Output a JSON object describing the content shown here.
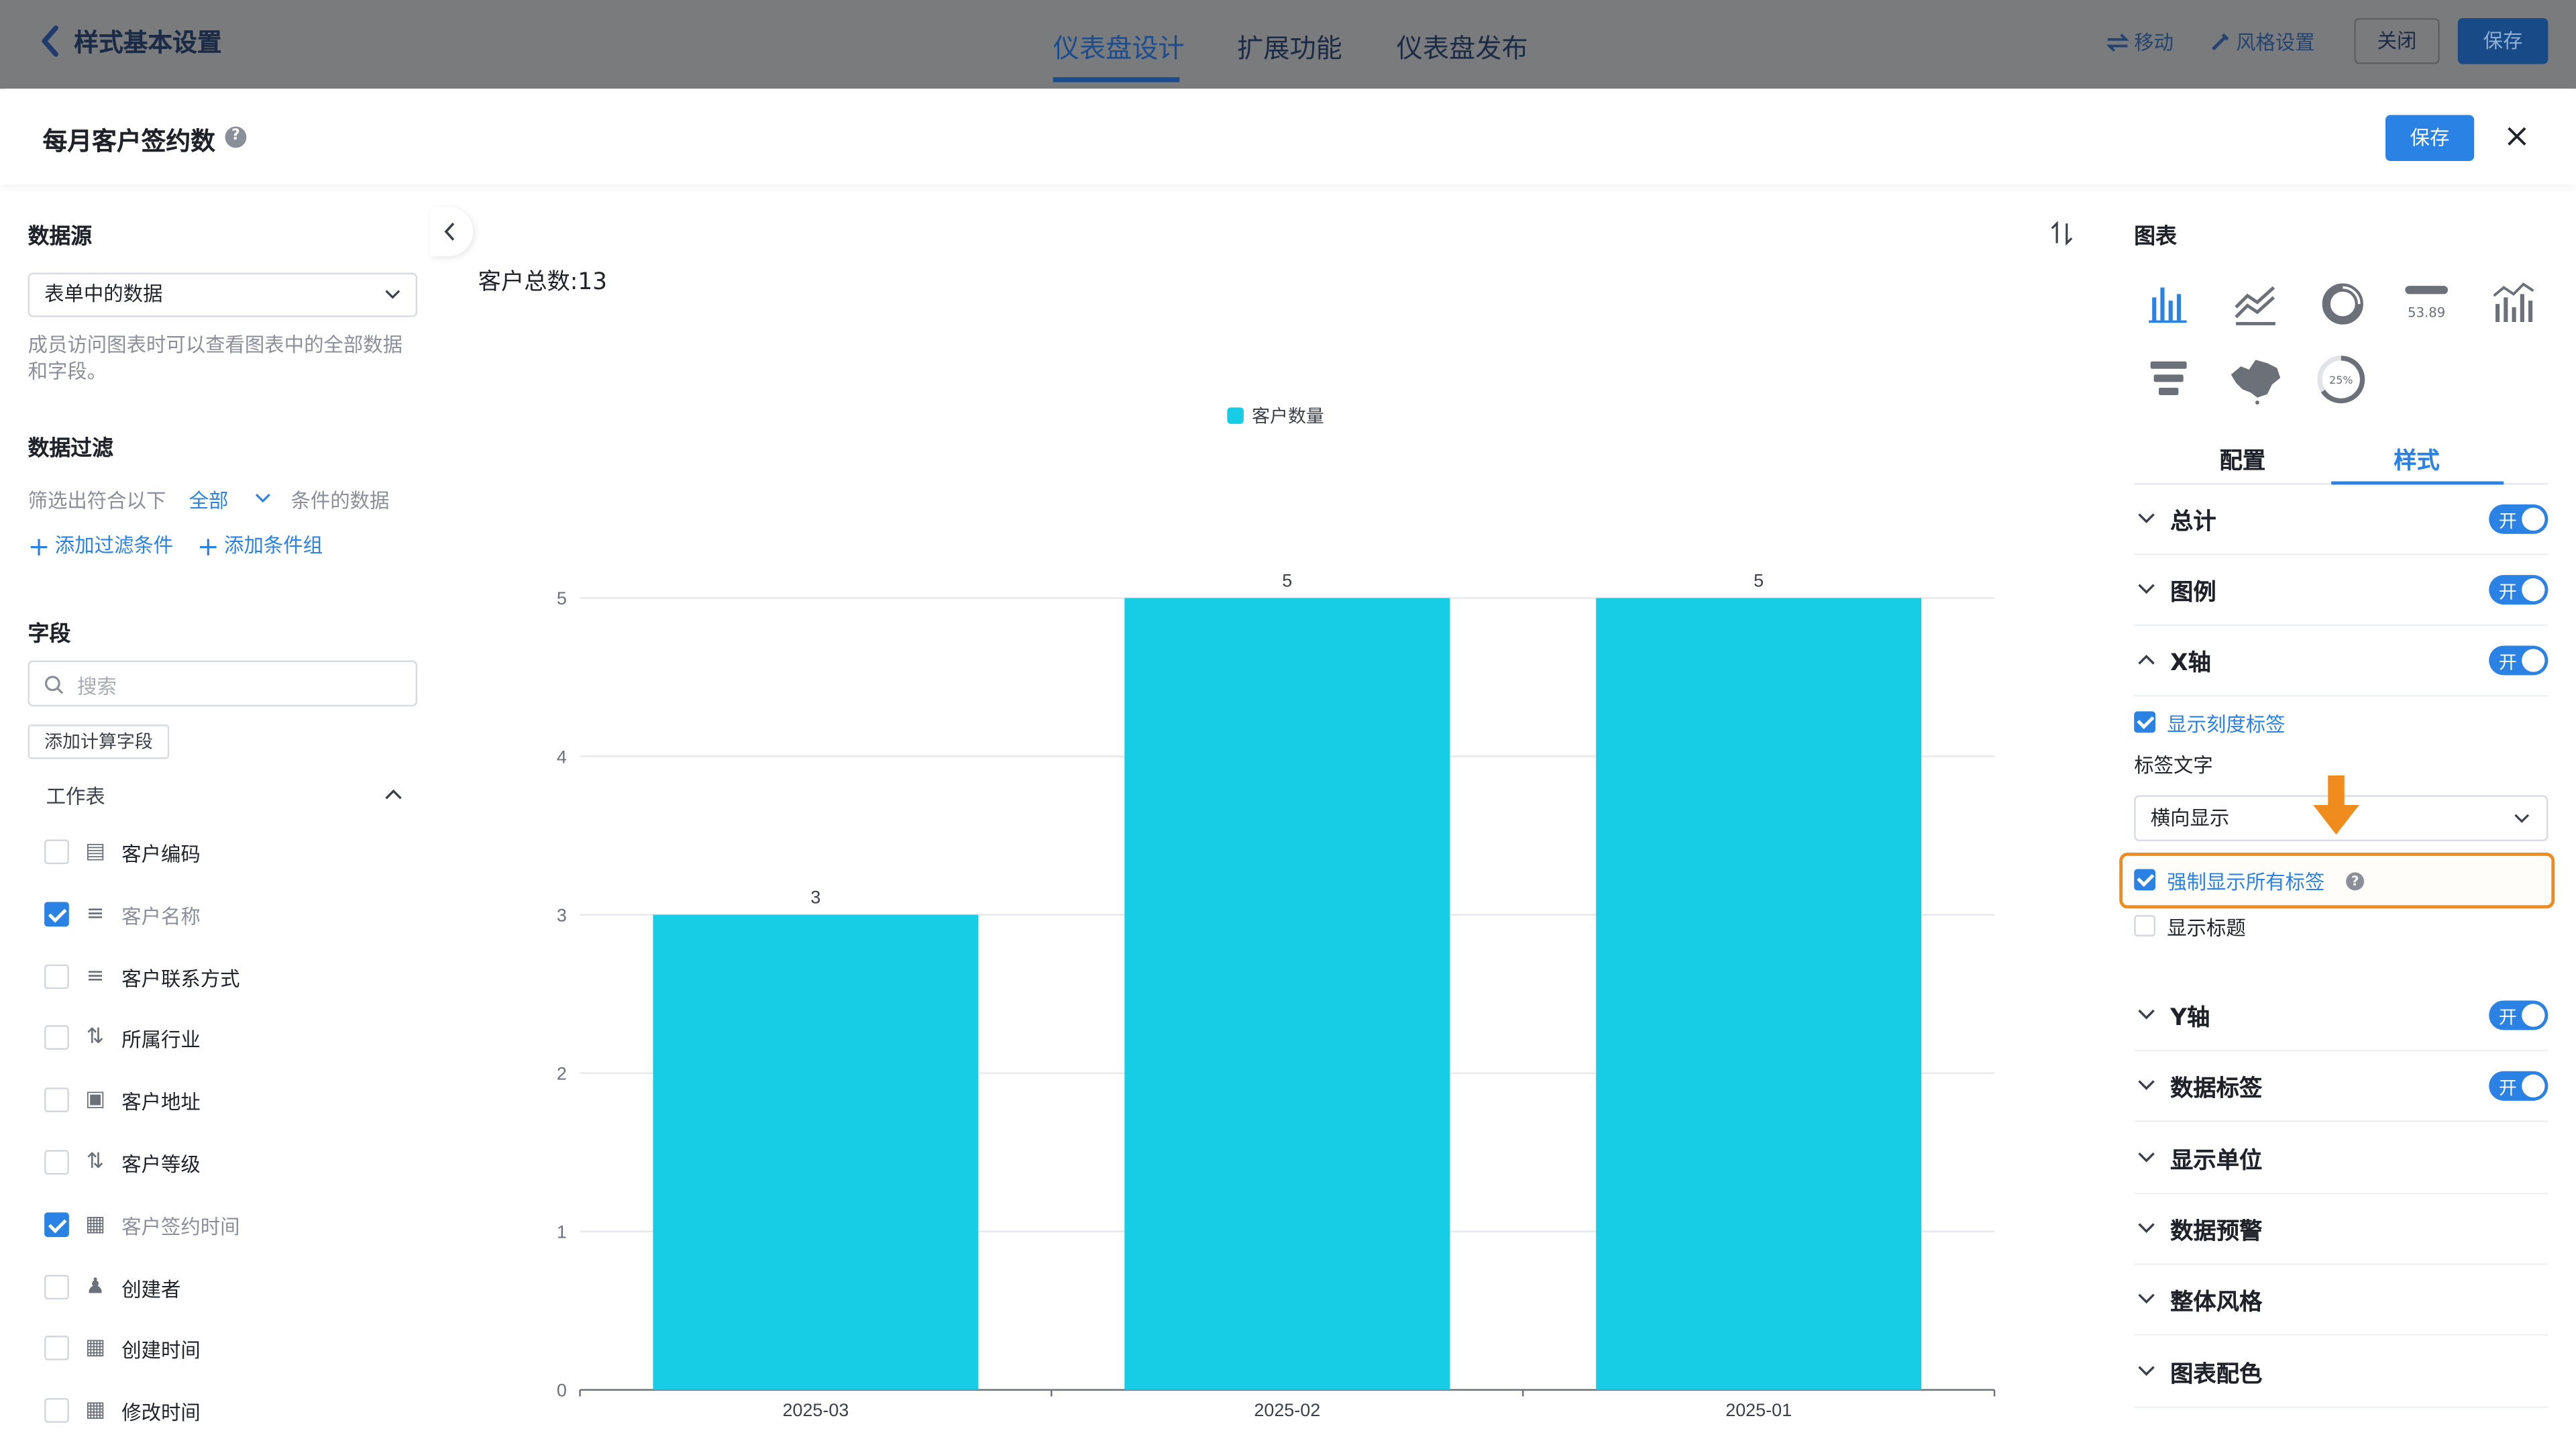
{
  "topbar": {
    "title": "样式基本设置",
    "tabs": [
      "仪表盘设计",
      "扩展功能",
      "仪表盘发布"
    ],
    "active_tab": "仪表盘设计",
    "move_label": "移动",
    "style_label": "风格设置",
    "close_label": "关闭",
    "save_label": "保存"
  },
  "modal": {
    "title": "每月客户签约数",
    "save_label": "保存"
  },
  "left": {
    "datasource_title": "数据源",
    "datasource_value": "表单中的数据",
    "datasource_hint": "成员访问图表时可以查看图表中的全部数据和字段。",
    "filter_title": "数据过滤",
    "filter_prefix": "筛选出符合以下",
    "filter_mode": "全部",
    "filter_suffix": "条件的数据",
    "add_condition": "添加过滤条件",
    "add_group": "添加条件组",
    "fields_title": "字段",
    "search_placeholder": "搜索",
    "calc_field": "添加计算字段",
    "group_label": "工作表",
    "fields": [
      {
        "name": "客户编码",
        "checked": false,
        "icon": "text-icon"
      },
      {
        "name": "客户名称",
        "checked": true,
        "icon": "lines-icon"
      },
      {
        "name": "客户联系方式",
        "checked": false,
        "icon": "lines-icon"
      },
      {
        "name": "所属行业",
        "checked": false,
        "icon": "sort-icon"
      },
      {
        "name": "客户地址",
        "checked": false,
        "icon": "building-icon"
      },
      {
        "name": "客户等级",
        "checked": false,
        "icon": "sort-icon"
      },
      {
        "name": "客户签约时间",
        "checked": true,
        "icon": "calendar-icon"
      },
      {
        "name": "创建者",
        "checked": false,
        "icon": "user-icon"
      },
      {
        "name": "创建时间",
        "checked": false,
        "icon": "calendar-icon"
      },
      {
        "name": "修改时间",
        "checked": false,
        "icon": "calendar-icon"
      }
    ]
  },
  "chart_header": {
    "total_label": "客户总数:13"
  },
  "chart_data": {
    "type": "bar",
    "categories": [
      "2025-03",
      "2025-02",
      "2025-01"
    ],
    "series": [
      {
        "name": "客户数量",
        "values": [
          3,
          5,
          5
        ],
        "color": "#17cde6"
      }
    ],
    "ylim": [
      0,
      5
    ],
    "yticks": [
      "0",
      "1",
      "2",
      "3",
      "4",
      "5"
    ],
    "legend_position": "top-center",
    "grid": true,
    "data_labels": true
  },
  "right": {
    "title": "图表",
    "chart_types": [
      "bar-chart-icon",
      "line-chart-icon",
      "pie-chart-icon",
      "indicator-card-icon",
      "combo-chart-icon",
      "funnel-chart-icon",
      "map-chart-icon",
      "gauge-chart-icon"
    ],
    "indicator_sample": "53.89",
    "gauge_sample": "25%",
    "tabs": [
      "配置",
      "样式"
    ],
    "active_tab": "样式",
    "switch_on_text": "开",
    "sections_top": [
      {
        "label": "总计",
        "switch": true,
        "expanded": false
      },
      {
        "label": "图例",
        "switch": true,
        "expanded": false
      },
      {
        "label": "X轴",
        "switch": true,
        "expanded": true
      }
    ],
    "x_axis": {
      "show_tick_labels": "显示刻度标签",
      "label_text_title": "标签文字",
      "label_direction": "横向显示",
      "force_all_labels": "强制显示所有标签",
      "show_title": "显示标题"
    },
    "sections_bottom": [
      {
        "label": "Y轴",
        "switch": true
      },
      {
        "label": "数据标签",
        "switch": true
      },
      {
        "label": "显示单位",
        "switch": false
      },
      {
        "label": "数据预警",
        "switch": false
      },
      {
        "label": "整体风格",
        "switch": false
      },
      {
        "label": "图表配色",
        "switch": false
      }
    ],
    "highlight_color": "#f08c1e"
  }
}
